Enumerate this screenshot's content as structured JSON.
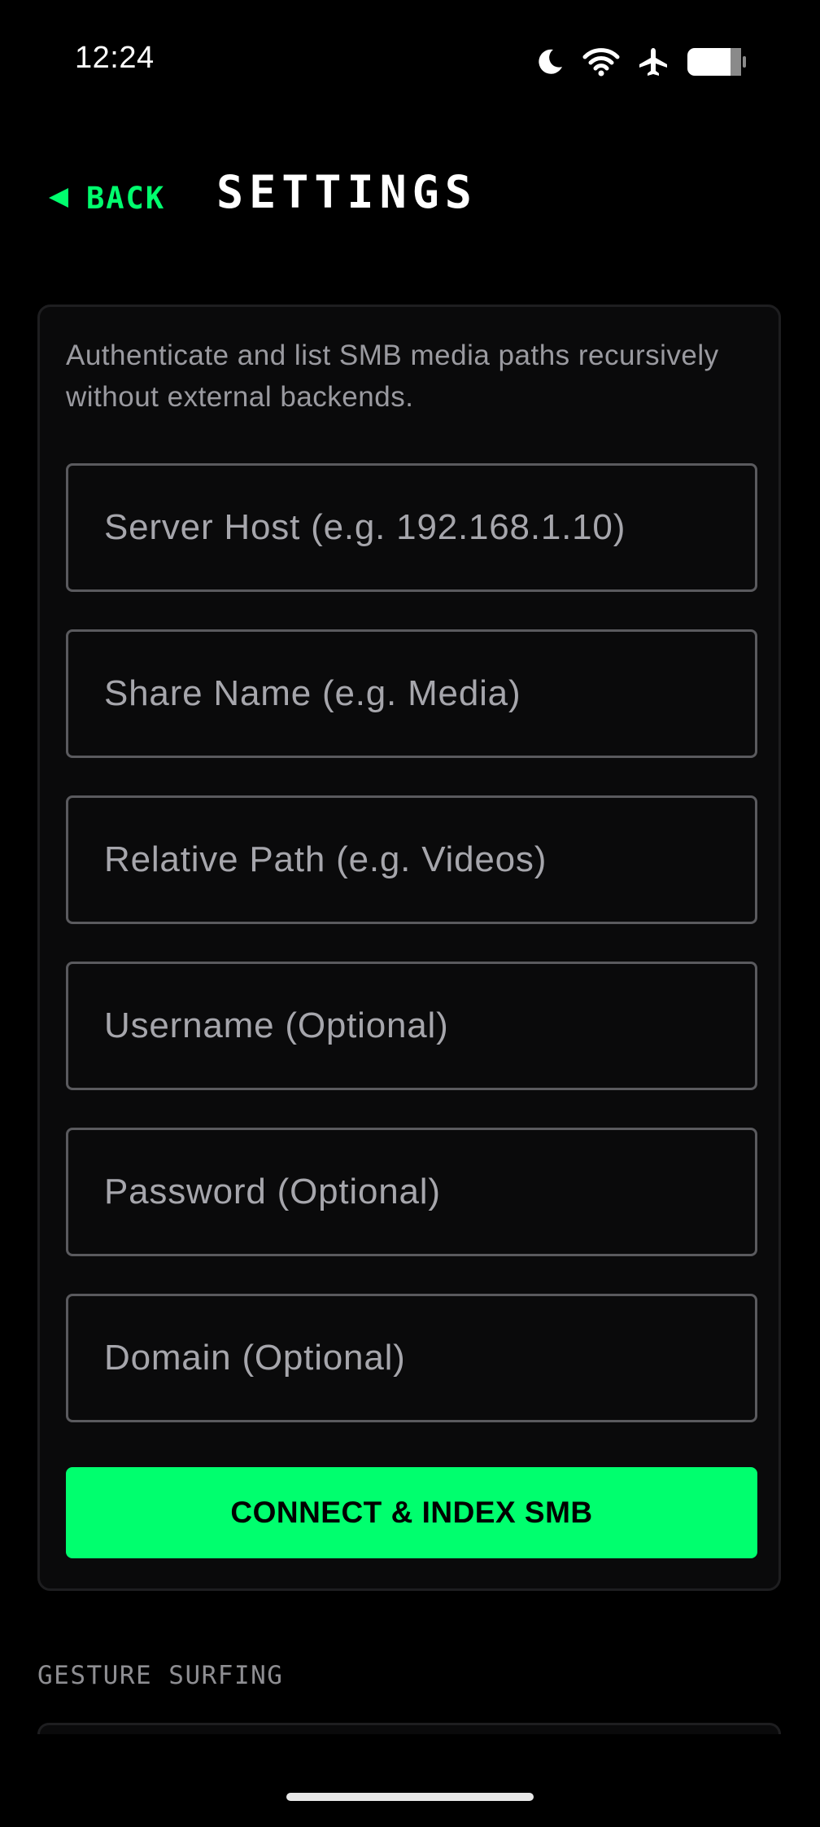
{
  "status_bar": {
    "time": "12:24",
    "icons": [
      "moon-icon",
      "wifi-icon",
      "airplane-icon",
      "battery-icon"
    ]
  },
  "header": {
    "back_label": "BACK",
    "title": "SETTINGS"
  },
  "smb_card": {
    "description": "Authenticate and list SMB media paths recursively without external backends.",
    "fields": {
      "server_host": {
        "placeholder": "Server Host (e.g. 192.168.1.10)",
        "value": ""
      },
      "share_name": {
        "placeholder": "Share Name (e.g. Media)",
        "value": ""
      },
      "relative_path": {
        "placeholder": "Relative Path (e.g. Videos)",
        "value": ""
      },
      "username": {
        "placeholder": "Username (Optional)",
        "value": ""
      },
      "password": {
        "placeholder": "Password (Optional)",
        "value": ""
      },
      "domain": {
        "placeholder": "Domain (Optional)",
        "value": ""
      }
    },
    "connect_label": "CONNECT & INDEX SMB"
  },
  "gesture_section": {
    "heading": "GESTURE SURFING"
  },
  "colors": {
    "accent": "#00ff6e",
    "background": "#000000",
    "card": "#0a0a0b",
    "field_border": "#5a5a5e",
    "placeholder": "#a6a6ac",
    "muted_text": "#9a9aa0"
  }
}
